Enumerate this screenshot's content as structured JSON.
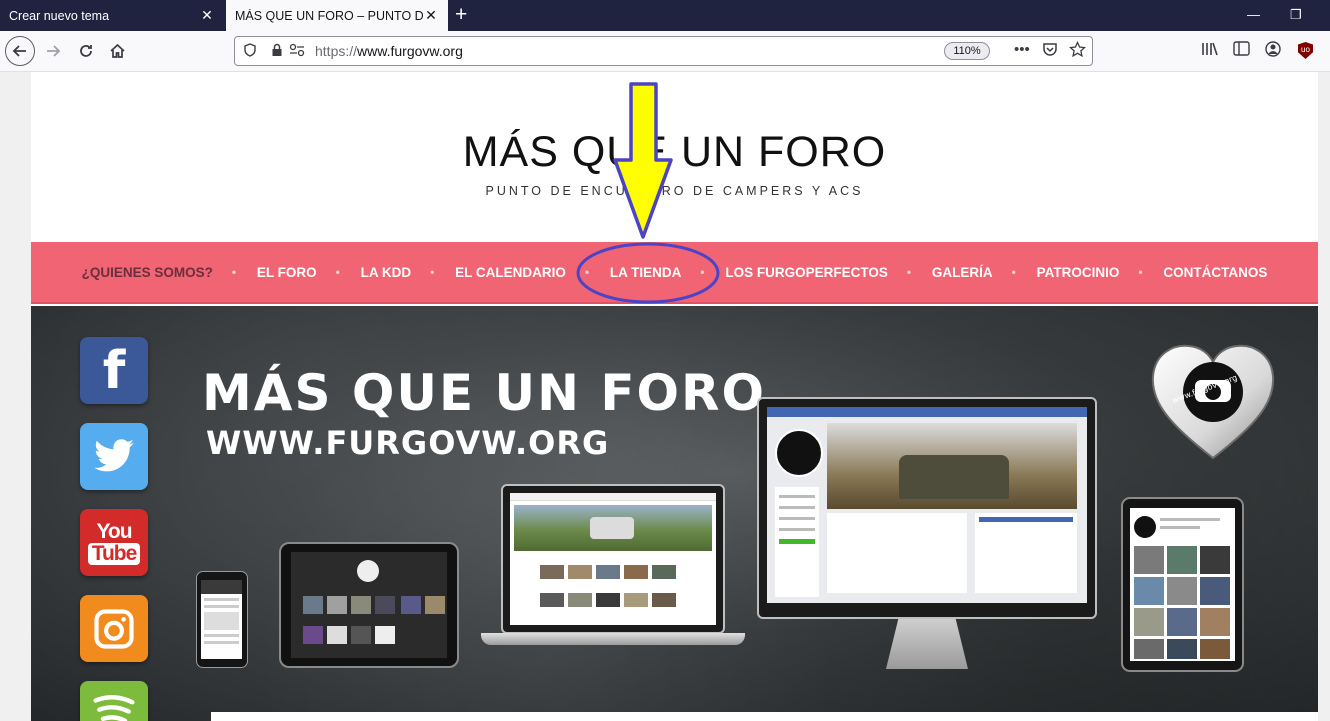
{
  "browser": {
    "tabs": [
      {
        "title": "Crear nuevo tema",
        "active": false
      },
      {
        "title": "MÁS QUE UN FORO – PUNTO DE ENCUENTRO DE CAMPERS Y ACS",
        "active": true
      }
    ],
    "url": {
      "protocol": "https://",
      "host": "www.furgovw.org"
    },
    "zoom": "110%",
    "icons": {
      "back": "back-arrow-icon",
      "forward": "forward-arrow-icon",
      "reload": "reload-icon",
      "home": "home-icon",
      "shield": "tracking-protection-shield-icon",
      "lock": "lock-icon",
      "permissions": "permissions-icon",
      "more": "more-actions-icon",
      "pocket": "pocket-icon",
      "bookmark": "star-bookmark-icon",
      "library": "library-icon",
      "sidebar": "sidebar-icon",
      "account": "account-icon",
      "ublock": "ublock-origin-icon",
      "minimize": "minimize-icon",
      "restore": "restore-icon",
      "close": "close-icon",
      "new_tab": "plus-icon"
    },
    "ublock_label": "uo"
  },
  "site": {
    "title": "MÁS QUE UN FORO",
    "tagline": "PUNTO DE ENCUENTRO DE CAMPERS Y ACS",
    "nav": [
      {
        "label": "¿QUIENES SOMOS?",
        "current": true
      },
      {
        "label": "EL FORO",
        "current": false
      },
      {
        "label": "LA KDD",
        "current": false
      },
      {
        "label": "EL CALENDARIO",
        "current": false
      },
      {
        "label": "LA TIENDA",
        "current": false,
        "highlighted": true
      },
      {
        "label": "LOS FURGOPERFECTOS",
        "current": false
      },
      {
        "label": "GALERÍA",
        "current": false
      },
      {
        "label": "PATROCINIO",
        "current": false
      },
      {
        "label": "CONTÁCTANOS",
        "current": false
      }
    ],
    "banner": {
      "headline": "MÁS QUE UN FORO",
      "subheadline": "WWW.FURGOVW.ORG",
      "heart_text": "www.furgovw.org",
      "social": [
        {
          "name": "facebook",
          "glyph": "f",
          "color": "#3b5998"
        },
        {
          "name": "twitter",
          "glyph": "🐦",
          "color": "#55acee"
        },
        {
          "name": "youtube",
          "glyph": "You Tube",
          "color": "#d32a2a"
        },
        {
          "name": "instagram",
          "glyph": "◎",
          "color": "#f28b1e"
        },
        {
          "name": "spotify",
          "glyph": "≋",
          "color": "#7dbb3c"
        }
      ]
    }
  },
  "annotation": {
    "arrow_color": "#ffff00",
    "arrow_outline": "#4b44c6",
    "circle_color": "#4b44c6"
  }
}
